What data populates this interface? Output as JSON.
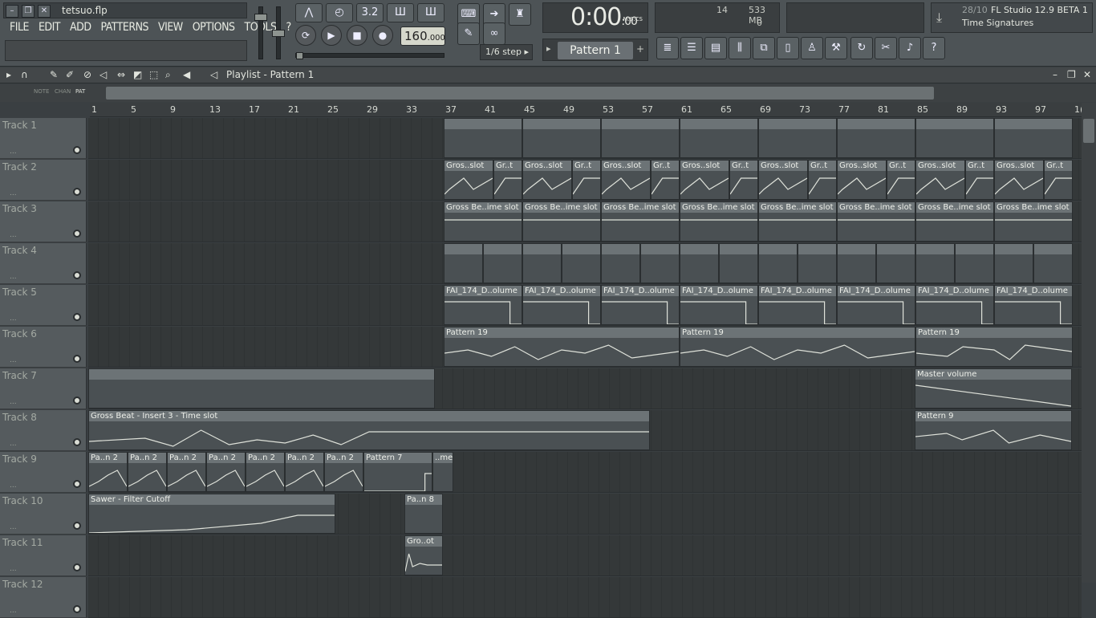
{
  "window": {
    "filename": "tetsuo.flp"
  },
  "menu": [
    "FILE",
    "EDIT",
    "ADD",
    "PATTERNS",
    "VIEW",
    "OPTIONS",
    "TOOLS",
    "?"
  ],
  "transport": {
    "time": "0:00",
    "time_small": ":00",
    "time_unit": "M:S:CS",
    "tempo": "160",
    "tempo_decimals": ".000",
    "snap": "1/6 step",
    "pattern": "Pattern 1"
  },
  "cpu": {
    "cpu_value": "14",
    "memory": "533 MB",
    "polyphony": "0"
  },
  "hint": {
    "counter": "28/10",
    "app": "FL Studio 12.9 BETA 1",
    "text": "Time Signatures"
  },
  "playlist": {
    "title": "Playlist - Pattern 1",
    "header_labels": [
      "NOTE",
      "CHAN",
      "PAT"
    ]
  },
  "ruler": [
    "1",
    "5",
    "9",
    "13",
    "17",
    "21",
    "25",
    "29",
    "33",
    "37",
    "41",
    "45",
    "49",
    "53",
    "57",
    "61",
    "65",
    "69",
    "73",
    "77",
    "81",
    "85",
    "89",
    "93",
    "97",
    "1("
  ],
  "tracks": [
    {
      "name": "Track 1",
      "dots": "..."
    },
    {
      "name": "Track 2",
      "dots": "..."
    },
    {
      "name": "Track 3",
      "dots": "..."
    },
    {
      "name": "Track 4",
      "dots": "..."
    },
    {
      "name": "Track 5",
      "dots": "..."
    },
    {
      "name": "Track 6",
      "dots": "..."
    },
    {
      "name": "Track 7",
      "dots": "..."
    },
    {
      "name": "Track 8",
      "dots": "..."
    },
    {
      "name": "Track 9",
      "dots": "..."
    },
    {
      "name": "Track 10",
      "dots": "..."
    },
    {
      "name": "Track 11",
      "dots": "..."
    },
    {
      "name": "Track 12",
      "dots": "..."
    }
  ],
  "clips": {
    "t2a": "Gros..slot",
    "t2b": "Gr..t",
    "t3": "Gross Be..ime slot",
    "t5": "FAI_174_D..olume",
    "t6": "Pattern 19",
    "t7": "Master volume",
    "t8a": "Gross Beat - Insert 3 - Time slot",
    "t8b": "Pattern 9",
    "t9a": "Pa..n 2",
    "t9b": "Pattern 7",
    "t9c": "..me",
    "t10a": "Sawer - Filter Cutoff",
    "t10b": "Pa..n 8",
    "t11": "Gro..ot"
  },
  "colors": {
    "accent": "#6c7376",
    "lane": "#343839",
    "header": "#555b5e"
  }
}
